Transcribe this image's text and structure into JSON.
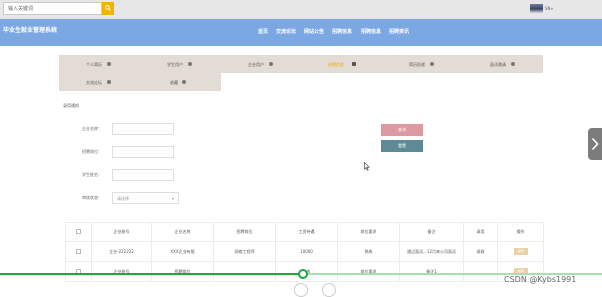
{
  "topbar": {
    "search_placeholder": "输入关键词",
    "user_name": "SN",
    "user_caret": "▾"
  },
  "navbar": {
    "site_title": "毕业生就业管理系统",
    "items": [
      "首页",
      "交流论坛",
      "网站公告",
      "招聘信息",
      "招聘信息",
      "招聘资讯"
    ]
  },
  "tabs": [
    "个人简历",
    "学生用户",
    "企业用户",
    "招聘信息",
    "简历投递",
    "面试邀请",
    "交流论坛",
    "收藏"
  ],
  "active_tab_index": 3,
  "form": {
    "section_title": "录用通知",
    "labels": {
      "company_name": "企业名称：",
      "position": "招聘岗位：",
      "student_name": "学生姓名：",
      "status": "审核状态："
    },
    "status_select_value": "请选择",
    "query_button": "查询",
    "reset_button": "重置"
  },
  "table": {
    "headers": [
      "",
      "企业账号",
      "企业名称",
      "招聘岗位",
      "工资待遇",
      "岗位要求",
      "备注",
      "录用",
      "操作"
    ],
    "rows": [
      [
        "",
        "企业-222222",
        "XXX企业有限",
        "网络工程师",
        "10000",
        "熟练",
        "通过面试，12月来公司面试",
        "录取",
        ""
      ],
      [
        "",
        "企业账号",
        "招聘岗位",
        "",
        "熟练",
        "岗位要求",
        "备注1",
        "",
        ""
      ]
    ],
    "action_label": "编辑"
  },
  "video_progress_percent": 50,
  "watermark": "CSDN @Kybs1991"
}
